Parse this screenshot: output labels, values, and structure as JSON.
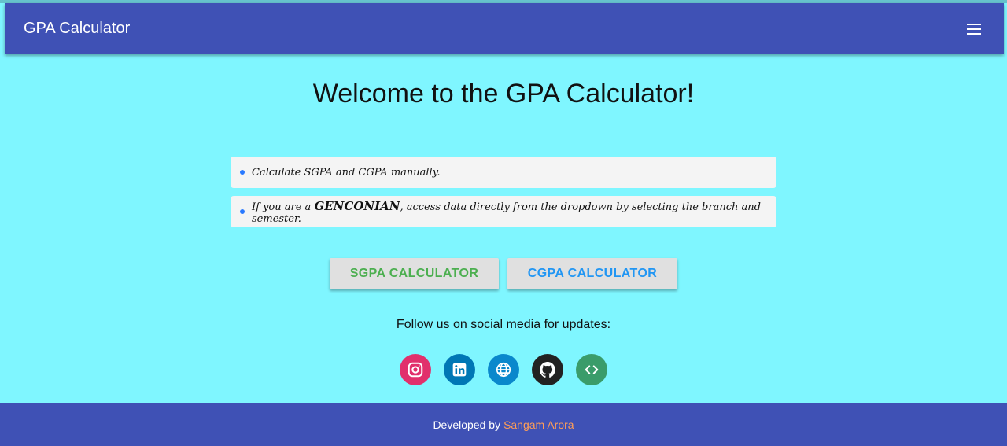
{
  "navbar": {
    "title": "GPA Calculator",
    "menu_icon": "hamburger-menu-icon"
  },
  "main": {
    "welcome": "Welcome to the GPA Calculator!",
    "info_items": [
      {
        "text": "Calculate SGPA and CGPA manually."
      },
      {
        "prefix": "If you are a ",
        "highlight": "GENCONIAN",
        "suffix": ", access data directly from the dropdown by selecting the branch and semester."
      }
    ],
    "buttons": {
      "sgpa": "SGPA CALCULATOR",
      "cgpa": "CGPA CALCULATOR"
    },
    "follow_text": "Follow us on social media for updates:",
    "social": [
      {
        "icon": "instagram-icon",
        "color": "#e1306c"
      },
      {
        "icon": "linkedin-icon",
        "color": "#0077b5"
      },
      {
        "icon": "globe-icon",
        "color": "#0a88cc"
      },
      {
        "icon": "github-icon",
        "color": "#222222"
      },
      {
        "icon": "code-icon",
        "color": "#3a9c6a"
      }
    ]
  },
  "footer": {
    "developed_by": "Developed by",
    "author": "Sangam Arora"
  },
  "colors": {
    "background": "#7ff6ff",
    "navbar": "#3f51b5",
    "sgpa_text": "#4caf50",
    "cgpa_text": "#2196f3",
    "author_link": "#ff9e57"
  }
}
